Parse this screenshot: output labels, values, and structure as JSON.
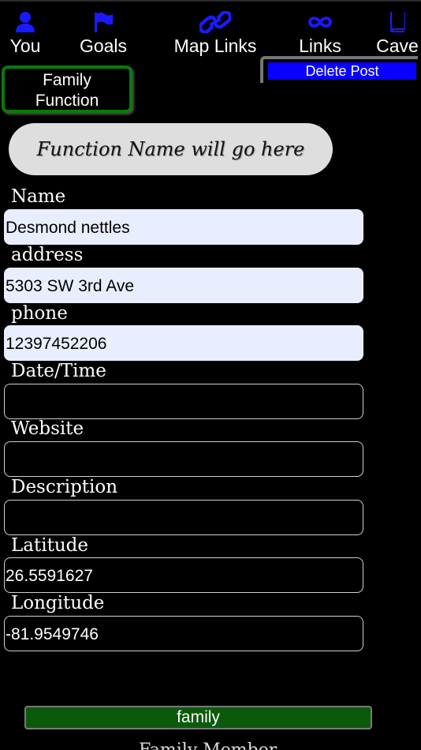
{
  "nav": {
    "items": [
      {
        "label": "You",
        "icon": "person-icon"
      },
      {
        "label": "Goals",
        "icon": "flag-icon"
      },
      {
        "label": "Map Links",
        "icon": "link-icon"
      },
      {
        "label": "Links",
        "icon": "infinity-icon"
      },
      {
        "label": "Cave",
        "icon": "book-icon"
      }
    ],
    "icon_color": "#1a1aff"
  },
  "delete_post_label": "Delete Post",
  "family_function_label": "Family\nFunction",
  "function_name_placeholder": "Function Name will go here",
  "fields": [
    {
      "label": "Name",
      "value": "Desmond nettles"
    },
    {
      "label": "address",
      "value": "5303 SW 3rd Ave"
    },
    {
      "label": "phone",
      "value": "12397452206"
    },
    {
      "label": "Date/Time",
      "value": ""
    },
    {
      "label": "Website",
      "value": ""
    },
    {
      "label": "Description",
      "value": ""
    },
    {
      "label": "Latitude",
      "value": "26.5591627"
    },
    {
      "label": "Longitude",
      "value": "-81.9549746"
    }
  ],
  "family_button_label": "family",
  "family_member_label": "Family Member"
}
